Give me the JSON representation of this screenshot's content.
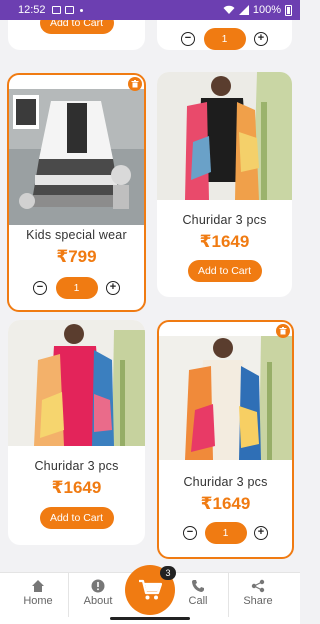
{
  "status_bar": {
    "time": "12:52",
    "battery": "100%"
  },
  "products": [
    {
      "id": "p0",
      "name": "",
      "price": "",
      "action": "cart",
      "cart_label": "Add to Cart"
    },
    {
      "id": "p1",
      "name": "",
      "price": "",
      "action": "stepper",
      "qty": "1"
    },
    {
      "id": "p2",
      "name": "Kids special wear",
      "price": "₹799",
      "action": "stepper",
      "qty": "1"
    },
    {
      "id": "p3",
      "name": "Churidar 3 pcs",
      "price": "₹1649",
      "action": "cart",
      "cart_label": "Add to Cart"
    },
    {
      "id": "p4",
      "name": "Churidar 3 pcs",
      "price": "₹1649",
      "action": "cart",
      "cart_label": "Add to Cart"
    },
    {
      "id": "p5",
      "name": "Churidar 3 pcs",
      "price": "₹1649",
      "action": "stepper",
      "qty": "1"
    }
  ],
  "stepper": {
    "minus": "−",
    "plus": "+"
  },
  "bottom_nav": {
    "items": [
      {
        "label": "Home",
        "icon": "home-icon"
      },
      {
        "label": "About",
        "icon": "info-icon"
      },
      {
        "label": "Call",
        "icon": "phone-icon"
      },
      {
        "label": "Share",
        "icon": "share-icon"
      }
    ],
    "cart_count": "3",
    "cart_icon": "cart-icon"
  },
  "colors": {
    "accent": "#f07b12",
    "status_bar": "#6c3fb1",
    "background": "#f2f2f4"
  }
}
